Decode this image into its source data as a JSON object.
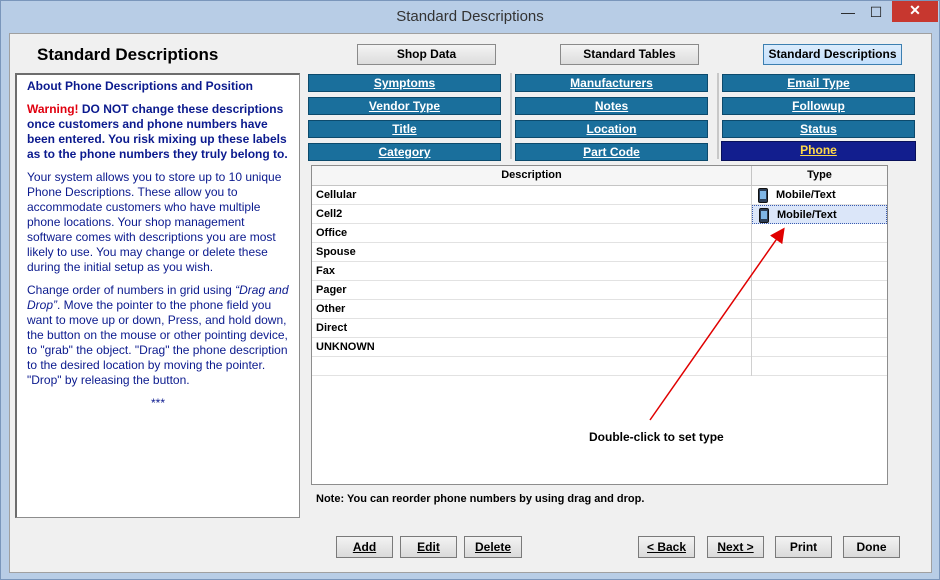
{
  "window": {
    "title": "Standard Descriptions",
    "minimize": "—",
    "maximize": "☐",
    "close": "✕"
  },
  "heading": "Standard Descriptions",
  "top_buttons": {
    "shop_data": "Shop Data",
    "standard_tables": "Standard Tables",
    "standard_descriptions": "Standard Descriptions"
  },
  "left_panel": {
    "title": "About Phone Descriptions and Position",
    "warning_label": "Warning!",
    "warning_text": " DO NOT change these descriptions once customers and phone numbers have been entered. You risk mixing up these labels as to the phone numbers they truly belong to.",
    "para1": "Your system allows you to store up to 10 unique Phone Descriptions. These allow you to accommodate customers who have multiple phone locations.  Your shop management software comes with descriptions you are most likely to use. You may change or delete these during the initial setup as you wish.",
    "para2_a": "Change order of numbers in grid using ",
    "para2_em": "“Drag and Drop”",
    "para2_b": ".  Move the pointer to the phone field you want to move up or down, Press, and hold down, the button on the mouse or other pointing device, to \"grab\" the object. \"Drag\" the phone description to the desired location by moving the pointer. \"Drop\" by releasing the button.",
    "stars": "***"
  },
  "categories": {
    "symptoms": "Symptoms",
    "manufacturers": "Manufacturers",
    "email_type": "Email Type",
    "vendor_type": "Vendor Type",
    "notes": "Notes",
    "followup": "Followup",
    "title": "Title",
    "location": "Location",
    "status": "Status",
    "category": "Category",
    "part_code": "Part Code",
    "phone": "Phone"
  },
  "grid": {
    "columns": [
      "Description",
      "Type"
    ],
    "rows": [
      {
        "description": "Cellular",
        "type": "Mobile/Text"
      },
      {
        "description": "Cell2",
        "type": "Mobile/Text"
      },
      {
        "description": "Office",
        "type": ""
      },
      {
        "description": "Spouse",
        "type": ""
      },
      {
        "description": "Fax",
        "type": ""
      },
      {
        "description": "Pager",
        "type": ""
      },
      {
        "description": "Other",
        "type": ""
      },
      {
        "description": "Direct",
        "type": ""
      },
      {
        "description": "UNKNOWN",
        "type": ""
      },
      {
        "description": "",
        "type": ""
      }
    ]
  },
  "callout": "Double-click to set type",
  "note": "Note: You can reorder phone numbers by using drag and drop.",
  "bottom_buttons": {
    "add": "Add",
    "edit": "Edit",
    "delete": "Delete",
    "back": "< Back",
    "next": "Next >",
    "print": "Print",
    "done": "Done"
  },
  "colors": {
    "category_button": "#1a6f9c",
    "selected_category": "#121e8e",
    "selected_text": "#ffd84a",
    "panel_text": "#0b1a8e",
    "warning": "#e0000f",
    "arrow": "#e00000"
  }
}
